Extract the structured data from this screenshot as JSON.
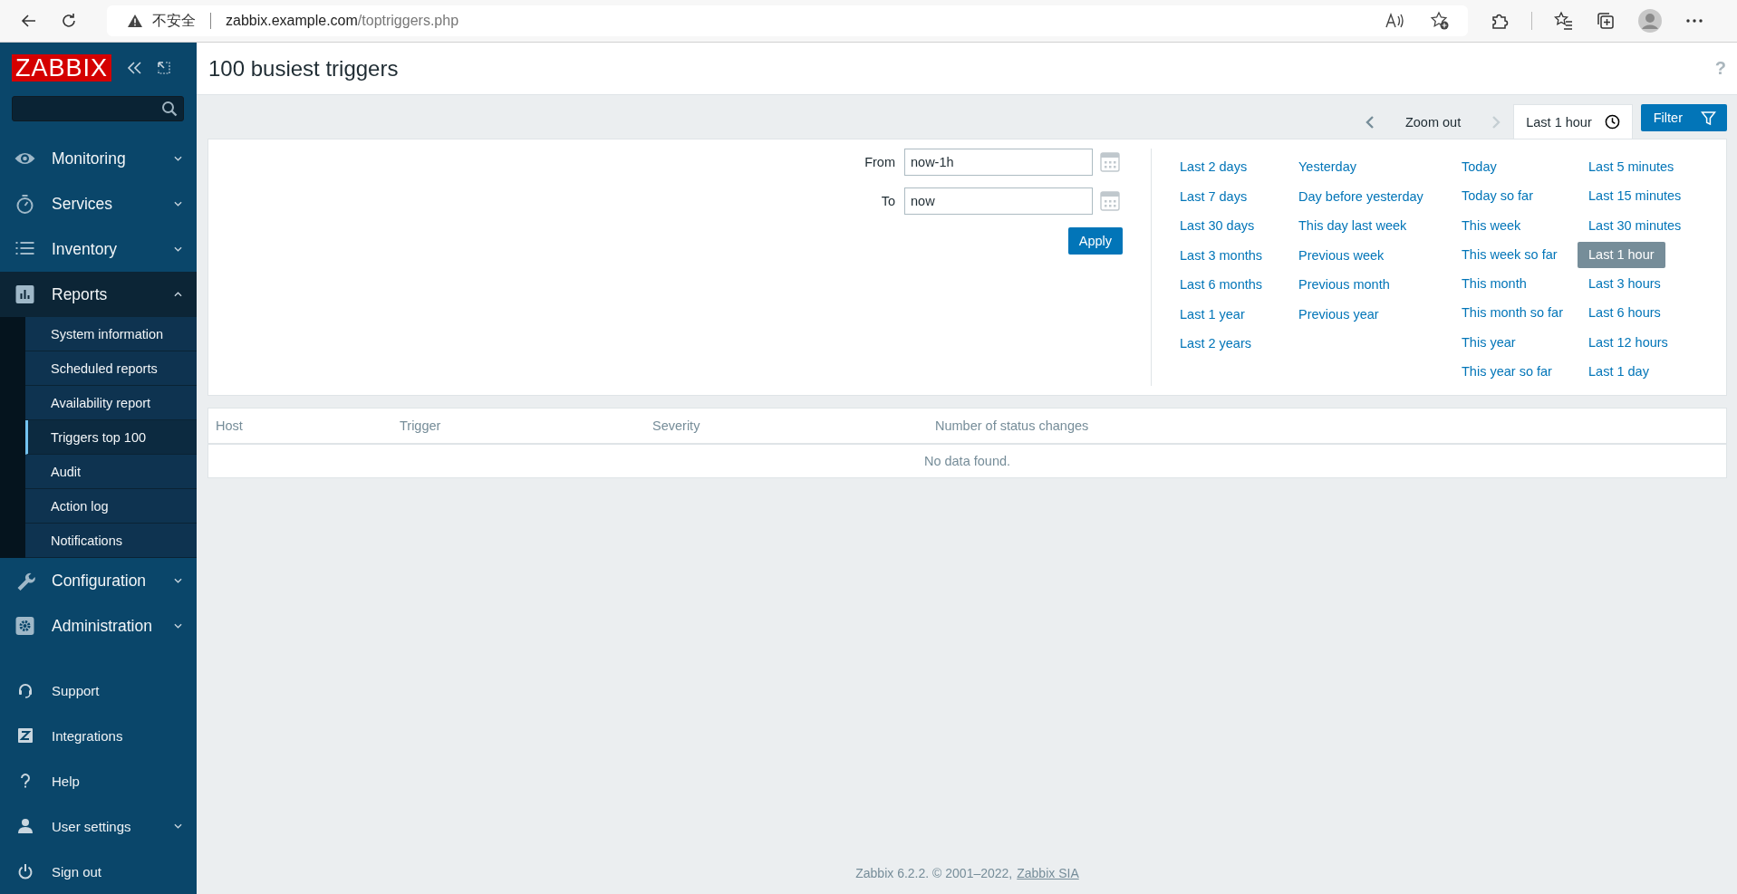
{
  "browser": {
    "security_label": "不安全",
    "url": "zabbix.example.com/toptriggers.php"
  },
  "sidebar": {
    "logo": "ZABBIX",
    "menu": [
      {
        "label": "Monitoring",
        "expanded": false
      },
      {
        "label": "Services",
        "expanded": false
      },
      {
        "label": "Inventory",
        "expanded": false
      },
      {
        "label": "Reports",
        "expanded": true,
        "children": [
          {
            "label": "System information",
            "selected": false
          },
          {
            "label": "Scheduled reports",
            "selected": false
          },
          {
            "label": "Availability report",
            "selected": false
          },
          {
            "label": "Triggers top 100",
            "selected": true
          },
          {
            "label": "Audit",
            "selected": false
          },
          {
            "label": "Action log",
            "selected": false
          },
          {
            "label": "Notifications",
            "selected": false
          }
        ]
      },
      {
        "label": "Configuration",
        "expanded": false
      },
      {
        "label": "Administration",
        "expanded": false
      }
    ],
    "user_menu": [
      {
        "label": "Support",
        "submenu": false
      },
      {
        "label": "Integrations",
        "submenu": false
      },
      {
        "label": "Help",
        "submenu": false
      },
      {
        "label": "User settings",
        "submenu": true
      },
      {
        "label": "Sign out",
        "submenu": false
      }
    ]
  },
  "page": {
    "title": "100 busiest triggers",
    "help": "?"
  },
  "time_nav": {
    "zoom_out": "Zoom out",
    "next_disabled": true,
    "tabs": [
      {
        "label": "Last 1 hour",
        "kind": "time",
        "selected": true
      },
      {
        "label": "Filter",
        "kind": "filter",
        "selected": false
      }
    ]
  },
  "filter": {
    "from_label": "From",
    "from_value": "now-1h",
    "to_label": "To",
    "to_value": "now",
    "apply": "Apply",
    "quick_ranges": [
      [
        {
          "label": "Last 2 days",
          "selected": false
        },
        {
          "label": "Last 7 days",
          "selected": false
        },
        {
          "label": "Last 30 days",
          "selected": false
        },
        {
          "label": "Last 3 months",
          "selected": false
        },
        {
          "label": "Last 6 months",
          "selected": false
        },
        {
          "label": "Last 1 year",
          "selected": false
        },
        {
          "label": "Last 2 years",
          "selected": false
        }
      ],
      [
        {
          "label": "Yesterday",
          "selected": false
        },
        {
          "label": "Day before yesterday",
          "selected": false
        },
        {
          "label": "This day last week",
          "selected": false
        },
        {
          "label": "Previous week",
          "selected": false
        },
        {
          "label": "Previous month",
          "selected": false
        },
        {
          "label": "Previous year",
          "selected": false
        }
      ],
      [
        {
          "label": "Today",
          "selected": false
        },
        {
          "label": "Today so far",
          "selected": false
        },
        {
          "label": "This week",
          "selected": false
        },
        {
          "label": "This week so far",
          "selected": false
        },
        {
          "label": "This month",
          "selected": false
        },
        {
          "label": "This month so far",
          "selected": false
        },
        {
          "label": "This year",
          "selected": false
        },
        {
          "label": "This year so far",
          "selected": false
        }
      ],
      [
        {
          "label": "Last 5 minutes",
          "selected": false
        },
        {
          "label": "Last 15 minutes",
          "selected": false
        },
        {
          "label": "Last 30 minutes",
          "selected": false
        },
        {
          "label": "Last 1 hour",
          "selected": true
        },
        {
          "label": "Last 3 hours",
          "selected": false
        },
        {
          "label": "Last 6 hours",
          "selected": false
        },
        {
          "label": "Last 12 hours",
          "selected": false
        },
        {
          "label": "Last 1 day",
          "selected": false
        }
      ]
    ]
  },
  "table": {
    "columns": [
      "Host",
      "Trigger",
      "Severity",
      "Number of status changes"
    ],
    "empty_message": "No data found."
  },
  "footer": {
    "text": "Zabbix 6.2.2. © 2001–2022,",
    "link": "Zabbix SIA"
  }
}
